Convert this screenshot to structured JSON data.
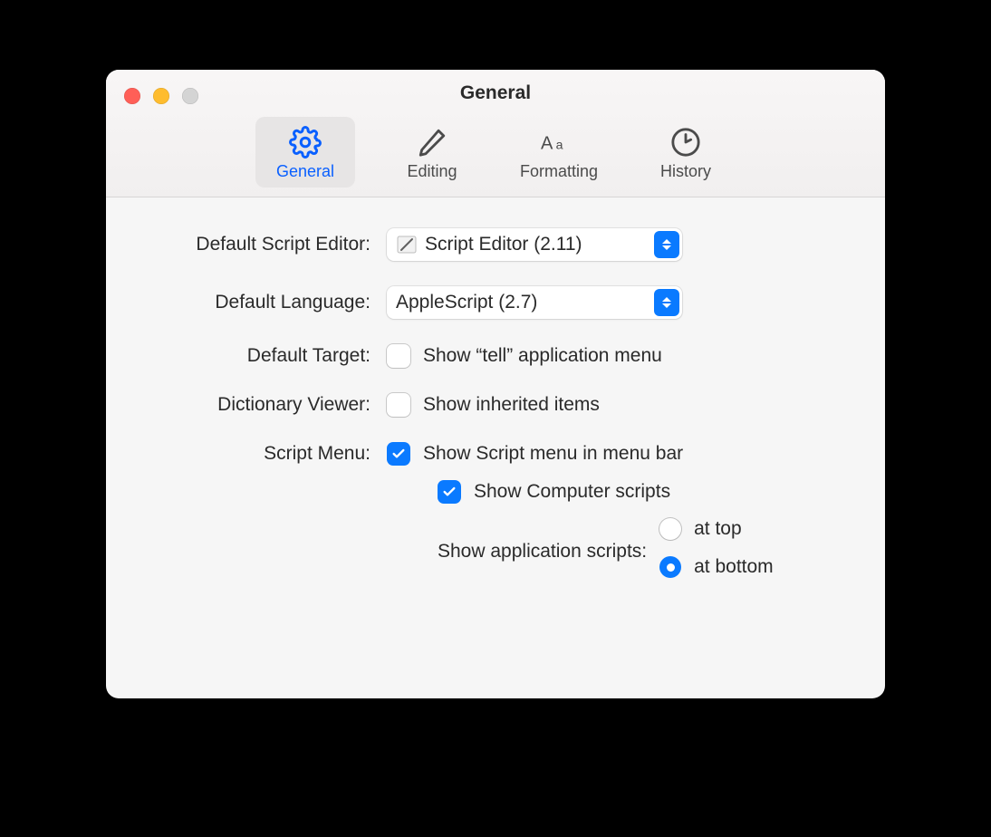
{
  "window": {
    "title": "General"
  },
  "toolbar": {
    "general": "General",
    "editing": "Editing",
    "formatting": "Formatting",
    "history": "History"
  },
  "fields": {
    "default_script_editor": {
      "label": "Default Script Editor:",
      "value": "Script Editor (2.11)"
    },
    "default_language": {
      "label": "Default Language:",
      "value": "AppleScript (2.7)"
    },
    "default_target": {
      "label": "Default Target:",
      "checkbox_label": "Show “tell” application menu"
    },
    "dictionary_viewer": {
      "label": "Dictionary Viewer:",
      "checkbox_label": "Show inherited items"
    },
    "script_menu": {
      "label": "Script Menu:",
      "show_menu_label": "Show Script menu in menu bar",
      "show_computer_label": "Show Computer scripts",
      "app_scripts_label": "Show application scripts:",
      "at_top": "at top",
      "at_bottom": "at bottom"
    }
  }
}
